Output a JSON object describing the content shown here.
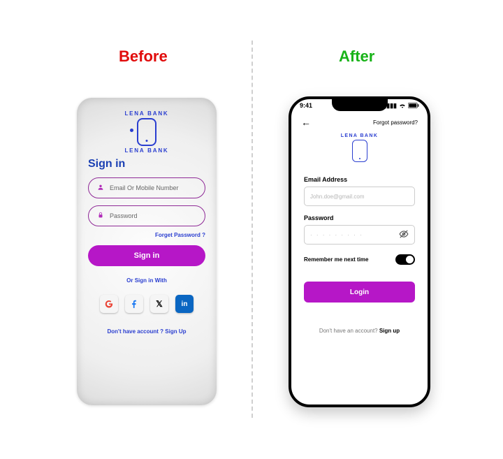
{
  "labels": {
    "before": "Before",
    "after": "After"
  },
  "brand": {
    "name": "LENA BANK"
  },
  "old": {
    "title": "Sign in",
    "email_placeholder": "Email Or Mobile Number",
    "password_placeholder": "Password",
    "forgot": "Forget Password ?",
    "signin_btn": "Sign in",
    "or_signin_with": "Or Sign in With",
    "no_account": "Don't have account ? Sign Up",
    "socials": {
      "google": "G",
      "facebook": "f",
      "x": "𝕏",
      "linkedin": "in"
    }
  },
  "new": {
    "status_time": "9:41",
    "forgot_top": "Forgot password?",
    "email_label": "Email Address",
    "email_placeholder": "John.doe@gmail.com",
    "password_label": "Password",
    "password_placeholder": "· · · · · · · · ·",
    "remember": "Remember me next time",
    "login_btn": "Login",
    "no_account_prefix": "Don't have an account? ",
    "no_account_action": "Sign up"
  }
}
